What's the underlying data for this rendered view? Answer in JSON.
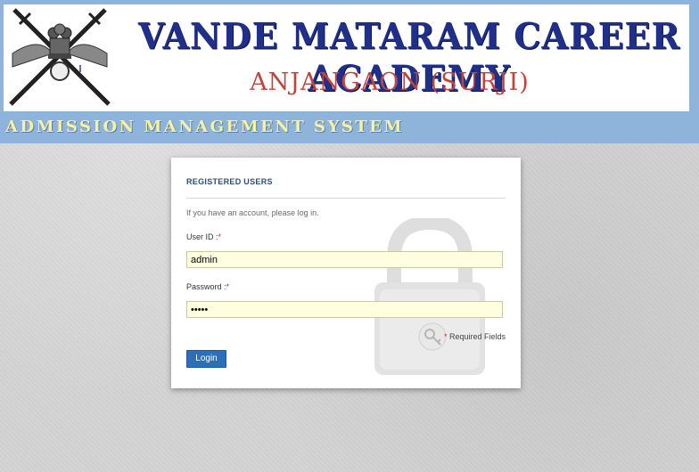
{
  "header": {
    "academy_name": "VANDE MATARAM CAREER ACADEMY",
    "location": "ANJANGAON (SURJI)",
    "system_name": "ADMISSION MANAGEMENT SYSTEM",
    "emblem_icon": "crossed-swords-lion-emblem-icon",
    "colors": {
      "bar": "#8eb4dc",
      "title": "#1f2f8a",
      "subtitle": "#c1443a",
      "system": "#f7f1a0"
    }
  },
  "login": {
    "section_title": "REGISTERED USERS",
    "intro": "If you have an account, please log in.",
    "user_id_label": "User ID :",
    "user_id_value": "admin",
    "password_label": "Password :",
    "password_value": "admin",
    "required_marker": "*",
    "required_note": "Required Fields",
    "login_label": "Login",
    "lock_icon": "padlock-icon",
    "key_icon": "key-icon",
    "colors": {
      "button": "#2c6fb7",
      "field_bg": "#ffffe0",
      "required": "#e02020"
    }
  }
}
